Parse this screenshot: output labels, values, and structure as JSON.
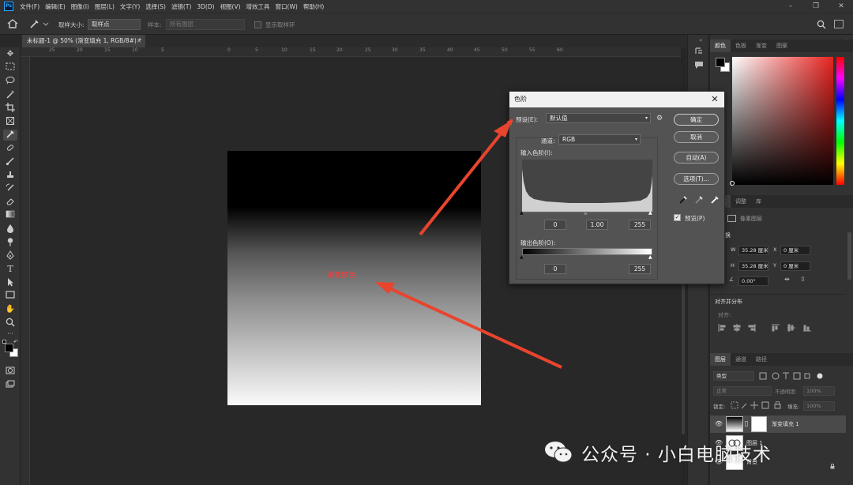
{
  "menubar": {
    "logo": "Ps",
    "items": [
      "文件(F)",
      "编辑(E)",
      "图像(I)",
      "图层(L)",
      "文字(Y)",
      "选择(S)",
      "滤镜(T)",
      "3D(D)",
      "视图(V)",
      "增效工具",
      "窗口(W)",
      "帮助(H)"
    ],
    "minimize": "–",
    "restore": "❐",
    "close": "✕"
  },
  "options": {
    "sample_size_label": "取样大小:",
    "sample_size_value": "取样点",
    "sample_label": "样本:",
    "sample_value": "所有图层",
    "show_ring_label": "显示取样环"
  },
  "tab": {
    "title": "未标题-1 @ 50% (渐变填充 1, RGB/8#) *",
    "close": "×"
  },
  "ruler": {
    "top_ticks": [
      "25",
      "20",
      "15",
      "10",
      "5",
      "0",
      "5",
      "10",
      "15",
      "20",
      "25",
      "30",
      "35",
      "40",
      "45",
      "50",
      "55",
      "60"
    ]
  },
  "canvas": {
    "overlay_text": "渐变颜色"
  },
  "levels_dialog": {
    "title": "色阶",
    "close": "✕",
    "preset_label": "预设(E):",
    "preset_value": "默认值",
    "channel_label": "通道:",
    "channel_value": "RGB",
    "input_levels_label": "输入色阶(I):",
    "input_black": "0",
    "input_gamma": "1.00",
    "input_white": "255",
    "output_levels_label": "输出色阶(O):",
    "output_black": "0",
    "output_white": "255",
    "ok": "确定",
    "cancel": "取消",
    "auto": "自动(A)",
    "options": "选项(T)...",
    "preview_label": "预览(P)",
    "preview_checked": true
  },
  "right_panel": {
    "color_tabs": [
      "颜色",
      "色板",
      "渐变",
      "图案"
    ],
    "props_tabs": [
      "属性",
      "调整",
      "库"
    ],
    "pixel_layer": "像素图层",
    "transform_title": "变换",
    "w_label": "W",
    "w_value": "35.28 厘米",
    "x_label": "X",
    "x_value": "0 厘米",
    "h_label": "H",
    "h_value": "35.28 厘米",
    "y_label": "Y",
    "y_value": "0 厘米",
    "angle_value": "0.00°",
    "align_title": "对齐并分布",
    "align_sub": "对齐:",
    "layers_tabs": [
      "图层",
      "通道",
      "路径"
    ],
    "filter_kind": "类型",
    "blend_mode": "正常",
    "opacity_label": "不透明度:",
    "opacity_value": "100%",
    "lock_label": "锁定:",
    "fill_label": "填充:",
    "fill_value": "100%",
    "layers": [
      {
        "name": "渐变填充 1"
      },
      {
        "name": "图层 1"
      },
      {
        "name": "背景"
      }
    ]
  },
  "colors": {
    "accent_red": "#ff3b3b",
    "arrow_red": "#e8442e"
  },
  "watermark": {
    "text": "公众号 · 小白电脑技术"
  }
}
